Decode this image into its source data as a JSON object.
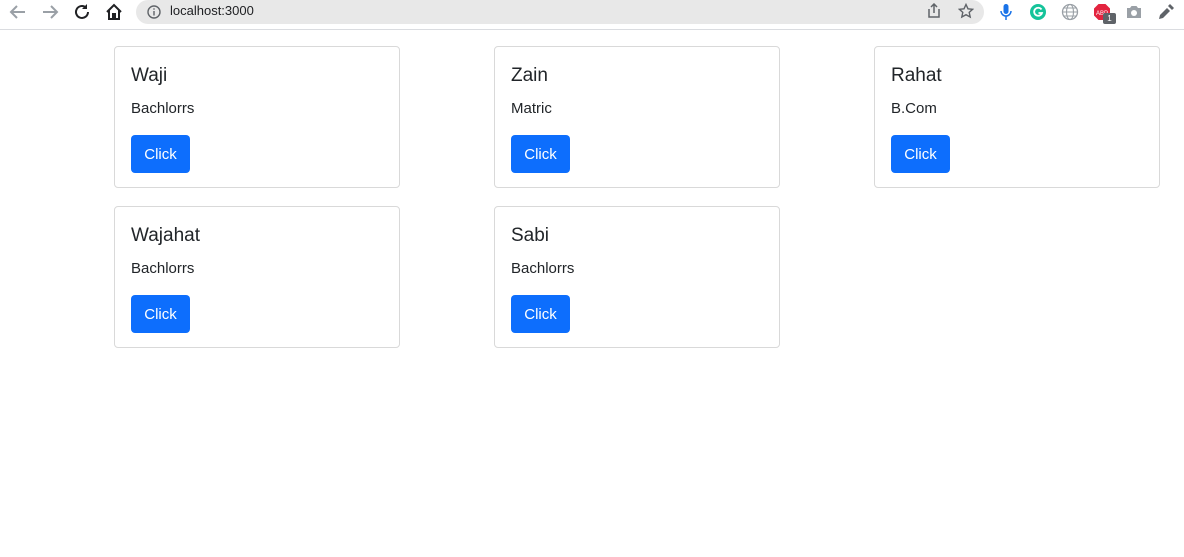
{
  "browser": {
    "url": "localhost:3000",
    "extension_badge": "1",
    "icons": [
      "back-arrow-icon",
      "forward-arrow-icon",
      "reload-icon",
      "home-icon",
      "info-icon",
      "share-icon",
      "star-icon",
      "microphone-icon",
      "grammarly-icon",
      "globe-icon",
      "adblock-icon",
      "camera-icon",
      "eyedropper-icon"
    ]
  },
  "cards": [
    {
      "name": "Waji",
      "degree": "Bachlorrs",
      "button": "Click"
    },
    {
      "name": "Zain",
      "degree": "Matric",
      "button": "Click"
    },
    {
      "name": "Rahat",
      "degree": "B.Com",
      "button": "Click"
    },
    {
      "name": "Wajahat",
      "degree": "Bachlorrs",
      "button": "Click"
    },
    {
      "name": "Sabi",
      "degree": "Bachlorrs",
      "button": "Click"
    }
  ],
  "colors": {
    "button": "#0d6efd",
    "card_border": "#d9d9d9",
    "text": "#212529"
  }
}
